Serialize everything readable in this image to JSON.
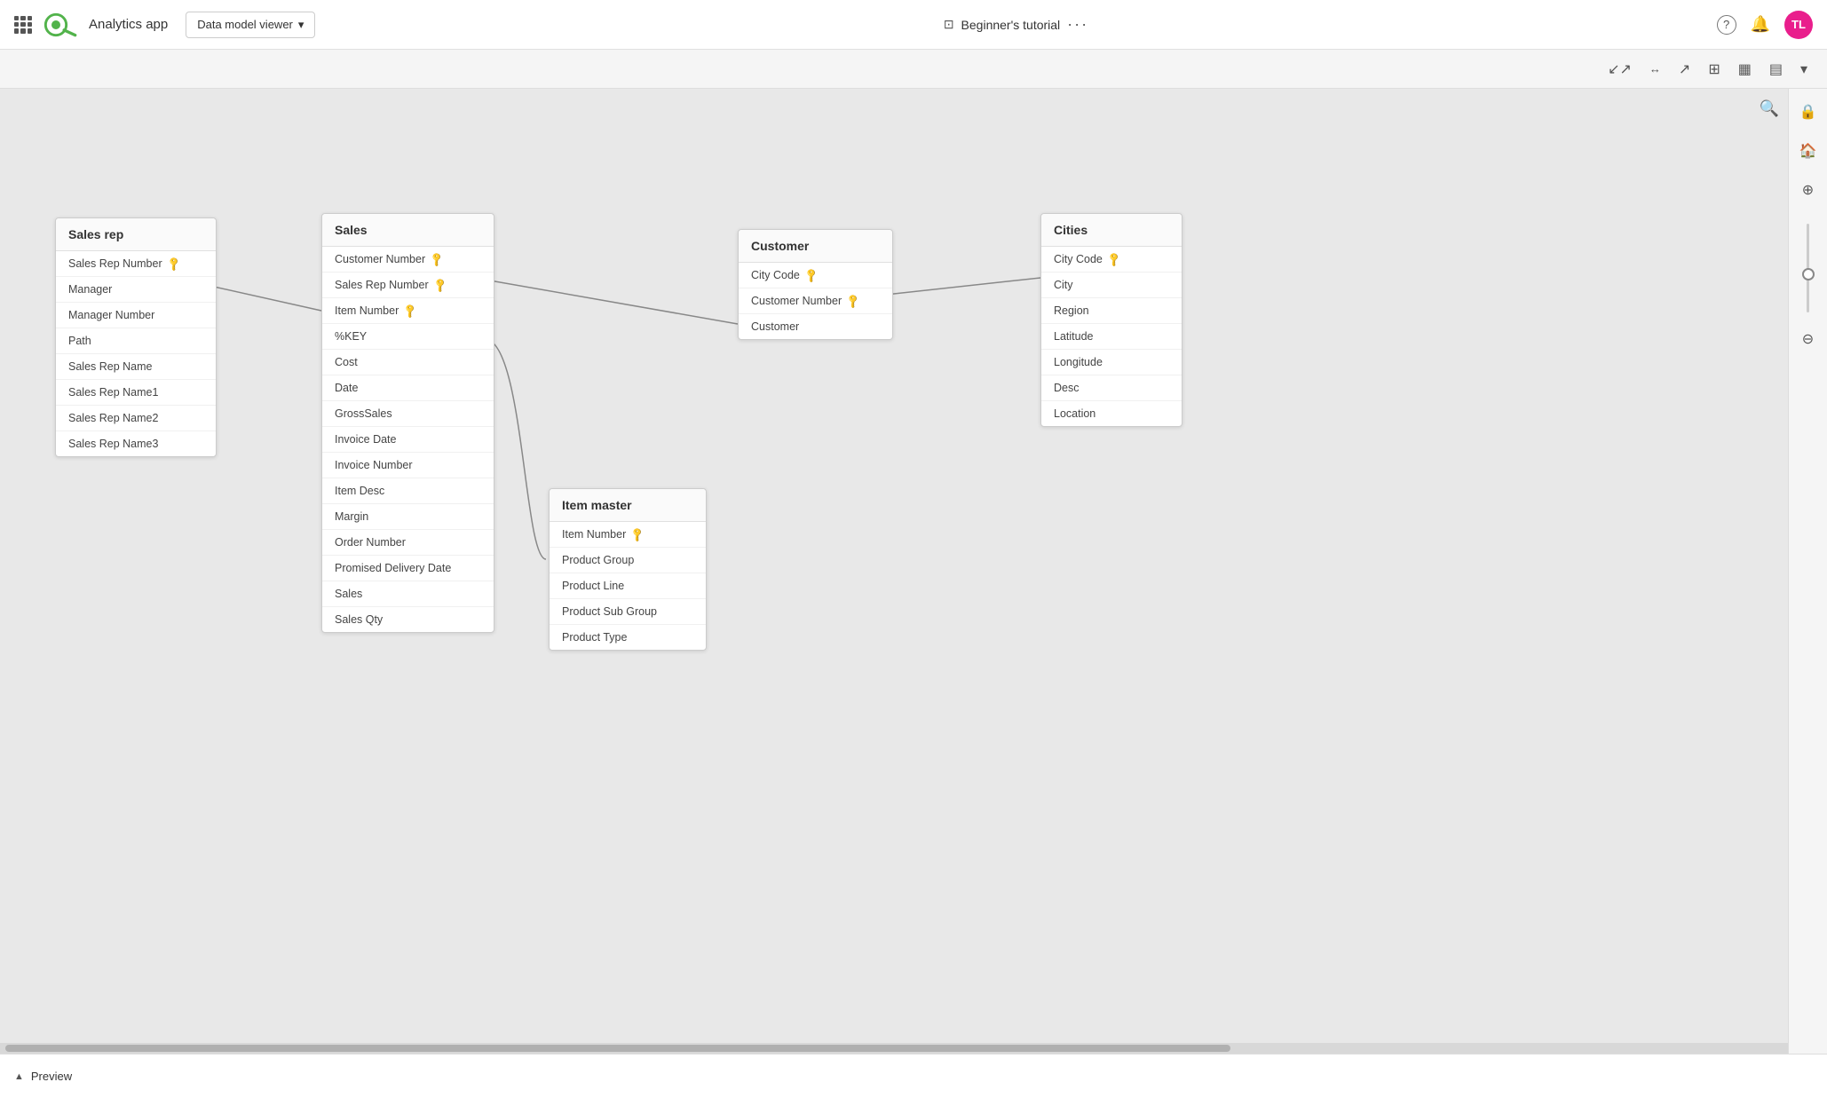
{
  "topbar": {
    "app_title": "Analytics app",
    "dropdown_label": "Data model viewer",
    "tutorial_label": "Beginner's tutorial",
    "help_icon": "?",
    "avatar_initials": "TL"
  },
  "toolbar": {
    "icons": [
      "↙",
      "↔",
      "↗",
      "⊞",
      "▦",
      "▤"
    ]
  },
  "tables": {
    "sales_rep": {
      "title": "Sales rep",
      "fields": [
        {
          "label": "Sales Rep Number",
          "key": true
        },
        {
          "label": "Manager",
          "key": false
        },
        {
          "label": "Manager Number",
          "key": false
        },
        {
          "label": "Path",
          "key": false
        },
        {
          "label": "Sales Rep Name",
          "key": false
        },
        {
          "label": "Sales Rep Name1",
          "key": false
        },
        {
          "label": "Sales Rep Name2",
          "key": false
        },
        {
          "label": "Sales Rep Name3",
          "key": false
        }
      ]
    },
    "sales": {
      "title": "Sales",
      "fields": [
        {
          "label": "Customer Number",
          "key": true
        },
        {
          "label": "Sales Rep Number",
          "key": true
        },
        {
          "label": "Item Number",
          "key": true
        },
        {
          "label": "%KEY",
          "key": false
        },
        {
          "label": "Cost",
          "key": false
        },
        {
          "label": "Date",
          "key": false
        },
        {
          "label": "GrossSales",
          "key": false
        },
        {
          "label": "Invoice Date",
          "key": false
        },
        {
          "label": "Invoice Number",
          "key": false
        },
        {
          "label": "Item Desc",
          "key": false
        },
        {
          "label": "Margin",
          "key": false
        },
        {
          "label": "Order Number",
          "key": false
        },
        {
          "label": "Promised Delivery Date",
          "key": false
        },
        {
          "label": "Sales",
          "key": false
        },
        {
          "label": "Sales Qty",
          "key": false
        }
      ]
    },
    "customer": {
      "title": "Customer",
      "fields": [
        {
          "label": "City Code",
          "key": true
        },
        {
          "label": "Customer Number",
          "key": true
        },
        {
          "label": "Customer",
          "key": false
        }
      ]
    },
    "cities": {
      "title": "Cities",
      "fields": [
        {
          "label": "City Code",
          "key": true
        },
        {
          "label": "City",
          "key": false
        },
        {
          "label": "Region",
          "key": false
        },
        {
          "label": "Latitude",
          "key": false
        },
        {
          "label": "Longitude",
          "key": false
        },
        {
          "label": "Desc",
          "key": false
        },
        {
          "label": "Location",
          "key": false
        }
      ]
    },
    "item_master": {
      "title": "Item master",
      "fields": [
        {
          "label": "Item Number",
          "key": true
        },
        {
          "label": "Product Group",
          "key": false
        },
        {
          "label": "Product Line",
          "key": false
        },
        {
          "label": "Product Sub Group",
          "key": false
        },
        {
          "label": "Product Type",
          "key": false
        }
      ]
    }
  },
  "preview": {
    "label": "Preview"
  }
}
